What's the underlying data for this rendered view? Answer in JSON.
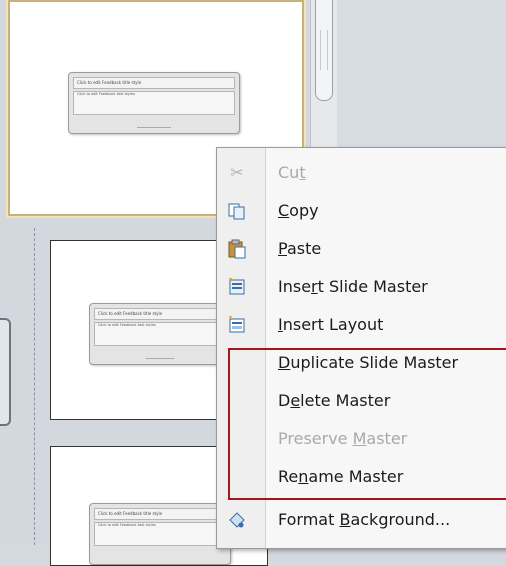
{
  "thumbnails": [
    {
      "title": "Click to edit Feedback title style",
      "body": "Click to edit Feedback text styles"
    },
    {
      "title": "Click to edit Feedback title style",
      "body": "Click to edit Feedback text styles"
    },
    {
      "title": "Click to edit Feedback title style",
      "body": "Click to edit Feedback text styles"
    }
  ],
  "context_menu": {
    "items": [
      {
        "label": "Cut",
        "icon": "scissors-icon",
        "enabled": false
      },
      {
        "label": "Copy",
        "icon": "copy-icon",
        "enabled": true
      },
      {
        "label": "Paste",
        "icon": "paste-icon",
        "enabled": true
      },
      {
        "label": "Insert Slide Master",
        "icon": "insert-slide-master-icon",
        "enabled": true
      },
      {
        "label": "Insert Layout",
        "icon": "insert-layout-icon",
        "enabled": true
      },
      {
        "label": "Duplicate Slide Master",
        "icon": "",
        "enabled": true
      },
      {
        "label": "Delete Master",
        "icon": "",
        "enabled": true
      },
      {
        "label": "Preserve Master",
        "icon": "",
        "enabled": false
      },
      {
        "label": "Rename Master",
        "icon": "",
        "enabled": true
      },
      {
        "label": "Format Background...",
        "icon": "format-background-icon",
        "enabled": true
      }
    ]
  },
  "colors": {
    "highlight_border": "#a4161d",
    "selected_slide_border": "#c9b277"
  }
}
